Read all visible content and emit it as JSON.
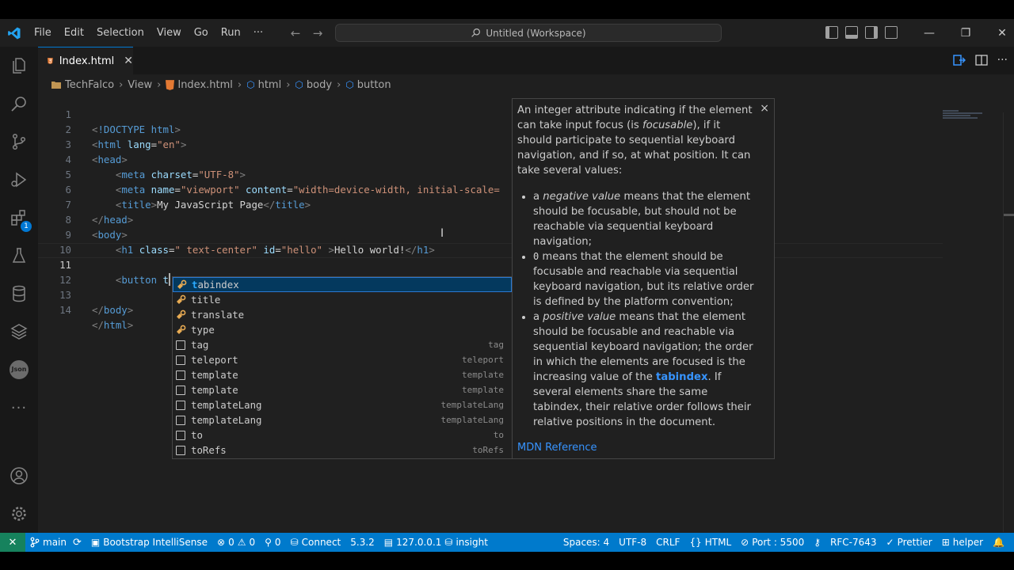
{
  "titlebar": {
    "menu": [
      "File",
      "Edit",
      "Selection",
      "View",
      "Go",
      "Run",
      "···"
    ],
    "search_text": "Untitled (Workspace)",
    "controls": {
      "minimize": "—",
      "restore": "❐",
      "close": "✕"
    }
  },
  "activity": {
    "extensions_badge": "1",
    "json_label": "Json"
  },
  "tab": {
    "label": "Index.html",
    "close": "✕"
  },
  "breadcrumbs": [
    "TechFalco",
    "View",
    "Index.html",
    "html",
    "body",
    "button"
  ],
  "code_lines": [
    {
      "n": "1"
    },
    {
      "n": "2"
    },
    {
      "n": "3"
    },
    {
      "n": "4"
    },
    {
      "n": "5"
    },
    {
      "n": "6"
    },
    {
      "n": "7"
    },
    {
      "n": "8"
    },
    {
      "n": "9"
    },
    {
      "n": "10"
    },
    {
      "n": "11"
    },
    {
      "n": "12"
    },
    {
      "n": "13"
    },
    {
      "n": "14"
    }
  ],
  "code": {
    "doctype": "!DOCTYPE html",
    "html_open": "html",
    "lang_attr": "lang",
    "lang_val": "\"en\"",
    "head": "head",
    "meta": "meta",
    "charset_attr": "charset",
    "charset_val": "\"UTF-8\"",
    "name_attr": "name",
    "name_val": "\"viewport\"",
    "content_attr": "content",
    "content_val": "\"width=device-width, initial-scale=",
    "title_tag": "title",
    "title_text": "My JavaScript Page",
    "body": "body",
    "h1": "h1",
    "class_attr": "class",
    "class_val": "\" text-center\"",
    "id_attr": "id",
    "id_val": "\"hello\"",
    "h1_text": "Hello world!",
    "button": "button",
    "typed": "t",
    "html_close": "html"
  },
  "suggestions": [
    {
      "label": "tabindex",
      "detail": "",
      "kind": "property",
      "selected": true
    },
    {
      "label": "title",
      "detail": "",
      "kind": "property"
    },
    {
      "label": "translate",
      "detail": "",
      "kind": "property"
    },
    {
      "label": "type",
      "detail": "",
      "kind": "property"
    },
    {
      "label": "tag",
      "detail": "tag",
      "kind": "snippet"
    },
    {
      "label": "teleport",
      "detail": "teleport",
      "kind": "snippet"
    },
    {
      "label": "template",
      "detail": "template",
      "kind": "snippet"
    },
    {
      "label": "template",
      "detail": "template",
      "kind": "snippet"
    },
    {
      "label": "templateLang",
      "detail": "templateLang",
      "kind": "snippet"
    },
    {
      "label": "templateLang",
      "detail": "templateLang",
      "kind": "snippet"
    },
    {
      "label": "to",
      "detail": "to",
      "kind": "snippet"
    },
    {
      "label": "toRefs",
      "detail": "toRefs",
      "kind": "snippet"
    }
  ],
  "details": {
    "intro_1": "An integer attribute indicating if the element can take input focus (is ",
    "intro_em": "focusable",
    "intro_2": "), if it should participate to sequential keyboard navigation, and if so, at what position. It can take several values:",
    "b1_pre": "a ",
    "b1_em": "negative value",
    "b1_rest": " means that the element should be focusable, but should not be reachable via sequential keyboard navigation;",
    "b2_code": "0",
    "b2_rest": " means that the element should be focusable and reachable via sequential keyboard navigation, but its relative order is defined by the platform convention;",
    "b3_pre": "a ",
    "b3_em": "positive value",
    "b3_mid": " means that the element should be focusable and reachable via sequential keyboard navigation; the order in which the elements are focused is the increasing value of the ",
    "b3_link": "tabindex",
    "b3_end": ". If several elements share the same tabindex, their relative order follows their relative positions in the document.",
    "reference": "MDN Reference",
    "close": "×"
  },
  "statusbar": {
    "remote": "✕",
    "branch": "main",
    "bootstrap": "Bootstrap IntelliSense",
    "errors": "0",
    "warnings": "0",
    "ports": "0",
    "connect": "Connect",
    "version": "5.3.2",
    "db_host": "127.0.0.1",
    "db_name": "insight",
    "spaces": "Spaces: 4",
    "encoding": "UTF-8",
    "eol": "CRLF",
    "language": "HTML",
    "port": "Port : 5500",
    "rfc": "RFC-7643",
    "prettier": "Prettier",
    "helper": "helper"
  },
  "colors": {
    "accent": "#0078d4",
    "statusbar": "#007acc",
    "remote": "#16825d",
    "html_icon": "#e37933",
    "suggest_highlight": "#2aaaff"
  }
}
